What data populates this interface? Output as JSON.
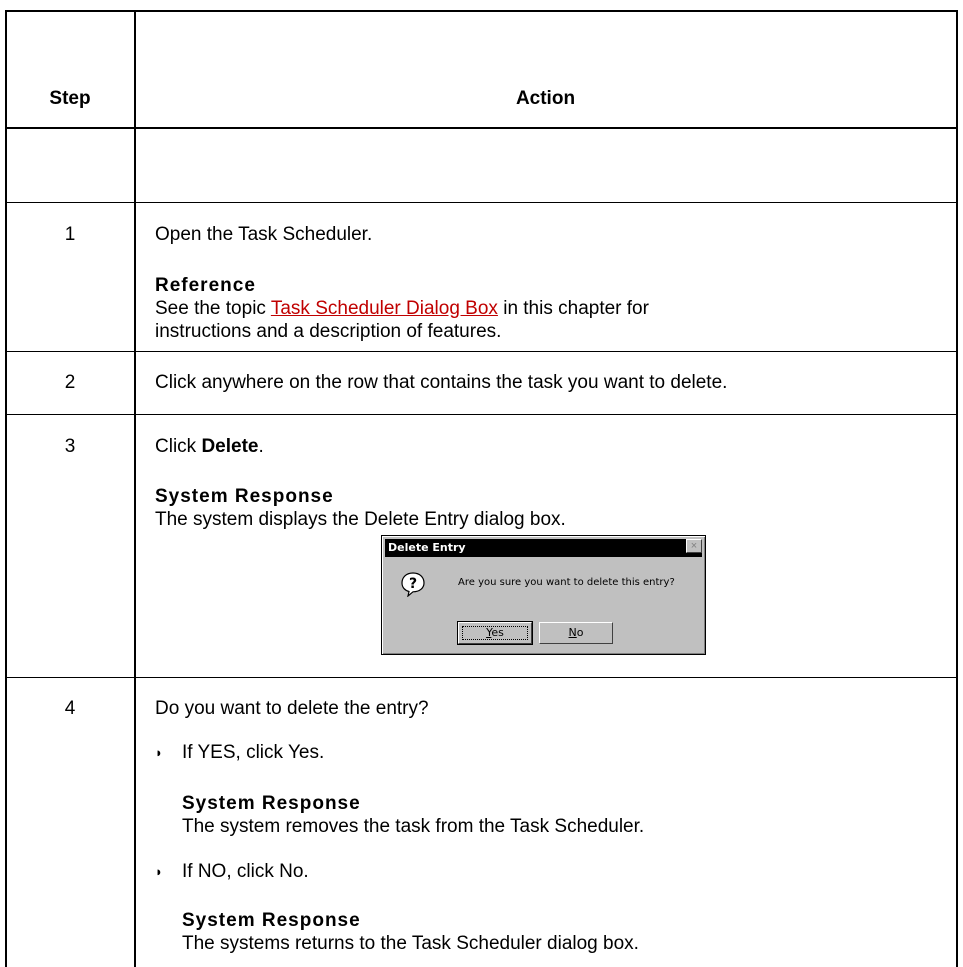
{
  "table": {
    "headers": {
      "step": "Step",
      "action": "Action"
    },
    "rows": [
      {
        "step": "1",
        "line1": "Open the Task Scheduler.",
        "subhead": "Reference",
        "ref_pre": "See the topic ",
        "ref_link": "Task Scheduler Dialog Box",
        "ref_post": " in this chapter for",
        "ref_line2": "instructions and a description of features."
      },
      {
        "step": "2",
        "line1": "Click anywhere on the row that contains the task you want to delete."
      },
      {
        "step": "3",
        "line1_pre": "Click ",
        "line1_bold": "Delete",
        "line1_post": ".",
        "subhead": "System Response",
        "line2": "The system displays the Delete Entry dialog box."
      },
      {
        "step": "4",
        "line1": "Do you want to delete the entry?",
        "bullet1": "If YES, click Yes.",
        "bullet1_subhead": "System Response",
        "bullet1_text": "The system removes the task from the Task Scheduler.",
        "bullet2": "If NO, click No.",
        "bullet2_subhead": "System Response",
        "bullet2_text": "The systems returns to the Task Scheduler dialog box."
      }
    ]
  },
  "dialog": {
    "title": "Delete Entry",
    "close_glyph": "×",
    "icon": "question-icon",
    "message": "Are you sure you want to delete this entry?",
    "yes_accel": "Y",
    "yes_rest": "es",
    "no_accel": "N",
    "no_rest": "o"
  },
  "bullet_glyph": "◗"
}
